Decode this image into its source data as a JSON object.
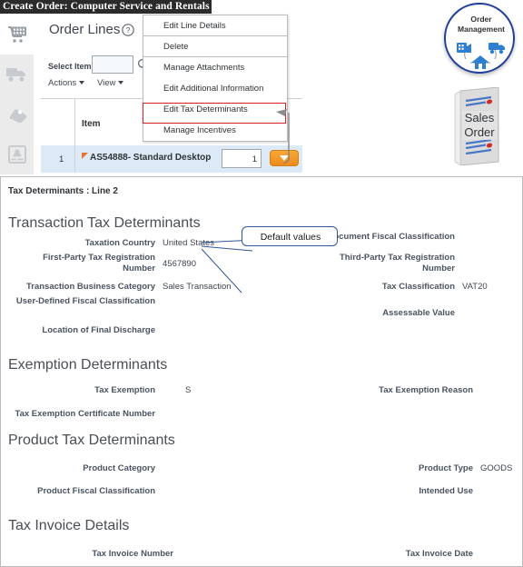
{
  "window": {
    "title": "Create Order: Computer Service and Rentals"
  },
  "sidebar": {
    "items": [
      {
        "name": "cart-icon",
        "label": "Order Lines",
        "active": true
      },
      {
        "name": "truck-icon",
        "label": "Shipment Details",
        "active": false
      },
      {
        "name": "tag-icon",
        "label": "Pricing",
        "active": false
      },
      {
        "name": "id-card-icon",
        "label": "Customer Details",
        "active": false
      }
    ]
  },
  "order_lines": {
    "heading": "Order Lines",
    "help_icon": "help-icon",
    "select_item": {
      "label": "Select Item",
      "value": "",
      "placeholder": "",
      "search_icon": "search-icon"
    },
    "toolbar": {
      "actions_label": "Actions",
      "view_label": "View"
    },
    "grid": {
      "columns": [
        "",
        "Item",
        "",
        ""
      ],
      "rows": [
        {
          "number": "1",
          "item": "AS54888- Standard Desktop",
          "quantity": "1",
          "dropdown_icon": "chevron-down-icon"
        }
      ]
    }
  },
  "context_menu": {
    "items": [
      {
        "label": "Edit Line Details",
        "separator_after": true,
        "highlighted": false
      },
      {
        "label": "Delete",
        "separator_after": true,
        "highlighted": false
      },
      {
        "label": "Manage Attachments",
        "separator_after": false,
        "highlighted": false
      },
      {
        "label": "Edit Additional Information",
        "separator_after": false,
        "highlighted": false
      },
      {
        "label": "Edit Tax Determinants",
        "separator_after": false,
        "highlighted": true
      },
      {
        "label": "Manage Incentives",
        "separator_after": false,
        "highlighted": false
      }
    ],
    "highlight_color": "#d81f1f"
  },
  "artwork": {
    "badge": {
      "line1": "Order",
      "line2": "Management",
      "ring_color": "#21409a",
      "icon_color": "#2f7fd1"
    },
    "document": {
      "line1": "Sales",
      "line2": "Order"
    }
  },
  "tax_panel": {
    "header": "Tax Determinants : Line 2",
    "callout": {
      "text": "Default  values",
      "border_color": "#2f5597"
    },
    "sections": [
      {
        "title": "Transaction Tax Determinants",
        "left_fields": [
          {
            "label": "Taxation Country",
            "value": "United States"
          },
          {
            "label": "First-Party Tax Registration Number",
            "value": "4567890"
          },
          {
            "label": "Transaction Business Category",
            "value": "Sales Transaction"
          },
          {
            "label": "User-Defined Fiscal Classification",
            "value": ""
          },
          {
            "label": "Location of Final Discharge",
            "value": ""
          }
        ],
        "right_fields": [
          {
            "label": "Document Fiscal Classification",
            "value": ""
          },
          {
            "label": "Third-Party Tax Registration Number",
            "value": ""
          },
          {
            "label": "Tax Classification",
            "value": "VAT20"
          },
          {
            "label": "Assessable Value",
            "value": ""
          }
        ]
      },
      {
        "title": "Exemption Determinants",
        "left_fields": [
          {
            "label": "Tax Exemption",
            "value": "S"
          },
          {
            "label": "Tax Exemption Certificate Number",
            "value": ""
          }
        ],
        "right_fields": [
          {
            "label": "Tax Exemption Reason",
            "value": ""
          }
        ]
      },
      {
        "title": "Product Tax Determinants",
        "left_fields": [
          {
            "label": "Product Category",
            "value": ""
          },
          {
            "label": "Product Fiscal Classification",
            "value": ""
          }
        ],
        "right_fields": [
          {
            "label": "Product Type",
            "value": "GOODS"
          },
          {
            "label": "Intended Use",
            "value": ""
          }
        ]
      },
      {
        "title": "Tax Invoice Details",
        "left_fields": [
          {
            "label": "Tax Invoice Number",
            "value": ""
          }
        ],
        "right_fields": [
          {
            "label": "Tax Invoice Date",
            "value": ""
          }
        ]
      }
    ]
  }
}
